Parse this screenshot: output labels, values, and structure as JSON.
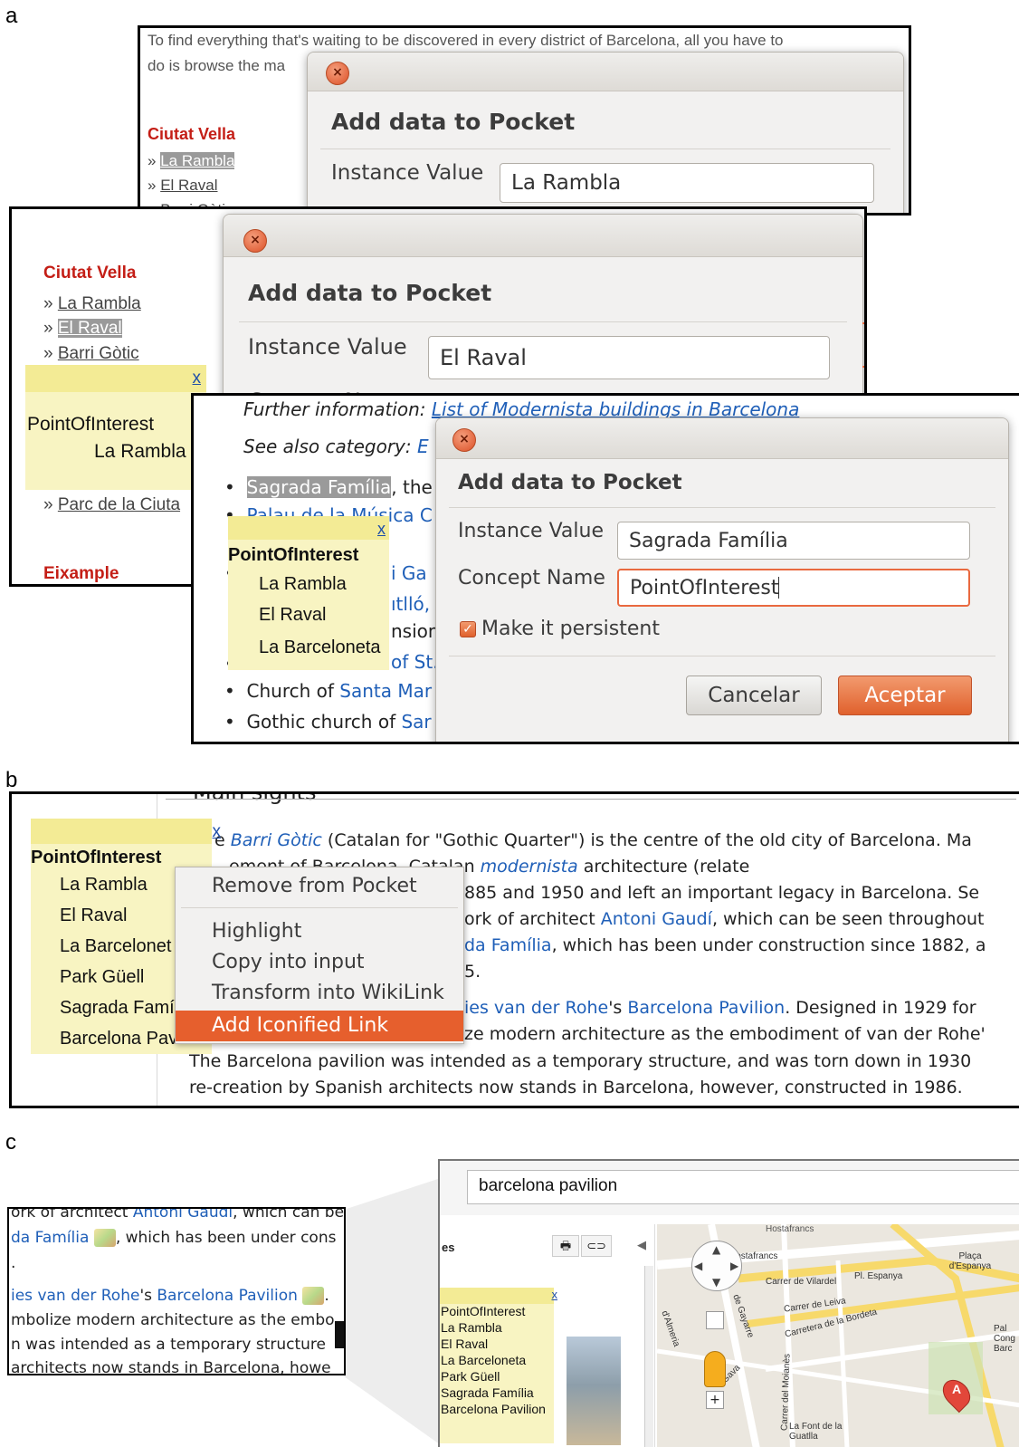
{
  "panel_labels": {
    "a": "a",
    "b": "b",
    "c": "c"
  },
  "panel_a": {
    "back": {
      "intro_line1": "To find everything that's waiting to be discovered in every district of Barcelona, all you have to",
      "intro_line2": "do is browse the ma",
      "district_title": "Ciutat Vella",
      "links": [
        "La Rambla",
        "El Raval",
        "Barri Gòtic"
      ],
      "dialog": {
        "close": "×",
        "title": "Add data to Pocket",
        "instance_label": "Instance Value",
        "instance_value": "La Rambla"
      }
    },
    "middle": {
      "district_title": "Ciutat Vella",
      "links": [
        "La Rambla",
        "El Raval",
        "Barri Gòtic"
      ],
      "bullet": "»",
      "pocket": {
        "close": "x",
        "concept": "PointOfInterest",
        "items": [
          "La Rambla"
        ]
      },
      "extra_link": "Parc de la Ciuta",
      "district2": "Eixample",
      "dialog": {
        "close": "×",
        "title": "Add data to Pocket",
        "instance_label": "Instance Value",
        "instance_value": "El Raval",
        "concept_label_partial": "Concept Name"
      }
    },
    "front": {
      "further_prefix": "Further information:",
      "further_link": "List of Modernista buildings in Barcelona",
      "see_also_prefix": "See also category:",
      "see_also_link": "E",
      "bullets": [
        {
          "plain_before": "",
          "link": "",
          "sel": "Sagrada Família",
          "after": ", the"
        },
        {
          "plain_before": "",
          "link": "Palau de la Música C",
          "sel": "",
          "after": ""
        },
        {
          "plain_before": "",
          "link": "",
          "sel": "",
          "after": ""
        },
        {
          "plain_before": "",
          "link": "",
          "sel": "",
          "after": ""
        },
        {
          "plain_before": "Church of ",
          "link": "Santa Mar",
          "sel": "",
          "after": ""
        },
        {
          "plain_before": "Gothic church of ",
          "link": "Sar",
          "sel": "",
          "after": ""
        }
      ],
      "fragments": [
        "i Ga",
        "ıtlló,",
        "nsion:",
        "of St.",
        "."
      ],
      "pocket": {
        "close": "x",
        "concept": "PointOfInterest",
        "items": [
          "La Rambla",
          "El Raval",
          "La Barceloneta"
        ]
      },
      "dialog": {
        "close": "×",
        "title": "Add data to Pocket",
        "instance_label": "Instance Value",
        "instance_value": "Sagrada Família",
        "concept_label": "Concept Name",
        "concept_value": "PointOfInterest",
        "persist_label": "Make it persistent",
        "persist_checked": true,
        "cancel": "Cancelar",
        "accept": "Aceptar"
      }
    }
  },
  "panel_b": {
    "heading_fragment": "Main sights",
    "pocket": {
      "close": "x",
      "concept": "PointOfInterest",
      "items": [
        "La Rambla",
        "El Raval",
        "La Barcelonet",
        "Park Güell",
        "Sagrada Famí",
        "Barcelona Pav"
      ]
    },
    "context_menu": [
      "Remove from Pocket",
      "Highlight",
      "Copy into input",
      "Transform into WikiLink",
      "Add Iconified Link"
    ],
    "active_item": "Add Iconified Link",
    "lines": {
      "l1_pre": "e ",
      "l1_link": "Barri Gòtic",
      "l1_post": " (Catalan for \"Gothic Quarter\") is the centre of the old city of Barcelona. Ma",
      "l2_pre": "ement of Barcelona. Catalan ",
      "l2_link": "modernista",
      "l2_post": " architecture (relate",
      "l3": "885 and 1950 and left an important legacy in Barcelona. Se",
      "l4_pre": "ork of architect ",
      "l4_link": "Antoni Gaudí",
      "l4_post": ", which can be seen throughout",
      "l5_link": "da Família",
      "l5_post": ", which has been under construction since 1882, a",
      "l6": "5.",
      "l7_link1": "ies van der Rohe",
      "l7_mid": "'s ",
      "l7_link2": "Barcelona Pavilion",
      "l7_post": ". Designed in 1929 for",
      "l8": "ze modern architecture as the embodiment of van der Rohe'",
      "l9": "The Barcelona pavilion was intended as a temporary structure, and was torn down in 1930",
      "l10": "re-creation by Spanish architects now stands in Barcelona, however, constructed in 1986."
    }
  },
  "panel_c": {
    "left": {
      "l1_pre": "ork of architect ",
      "l1_link": "Antoni Gaudí",
      "l1_post": ", which can be",
      "l2_link": "da Família",
      "l2_post": ", which has been under cons",
      "l3": ".",
      "l4_link1": "ies van der Rohe",
      "l4_mid": "'s ",
      "l4_link2": "Barcelona Pavilion",
      "l4_post": ".",
      "l5": "mbolize modern architecture as the embo",
      "l6": "n was intended as a temporary structure",
      "l7": " architects now stands in Barcelona, howe"
    },
    "right": {
      "search_value": "barcelona pavilion",
      "side_tab": "es",
      "pocket": {
        "close": "x",
        "concept": "PointOfInterest",
        "items": [
          "La Rambla",
          "El Raval",
          "La Barceloneta",
          "Park Güell",
          "Sagrada Família",
          "Barcelona Pavilion"
        ]
      },
      "map_labels": [
        "Hostafrancs",
        "Hostafrancs",
        "Carrer de Vilardel",
        "Pl. Espanya",
        "Plaça d'Espanya",
        "Carrer de Leiva",
        "Carretera de la Bordeta",
        "La Font de la Guatlla",
        "de Gayarre",
        "Carrer del Moianès",
        "d'Almeria",
        "Gava",
        "Pal Cong Barc",
        "A"
      ]
    }
  }
}
